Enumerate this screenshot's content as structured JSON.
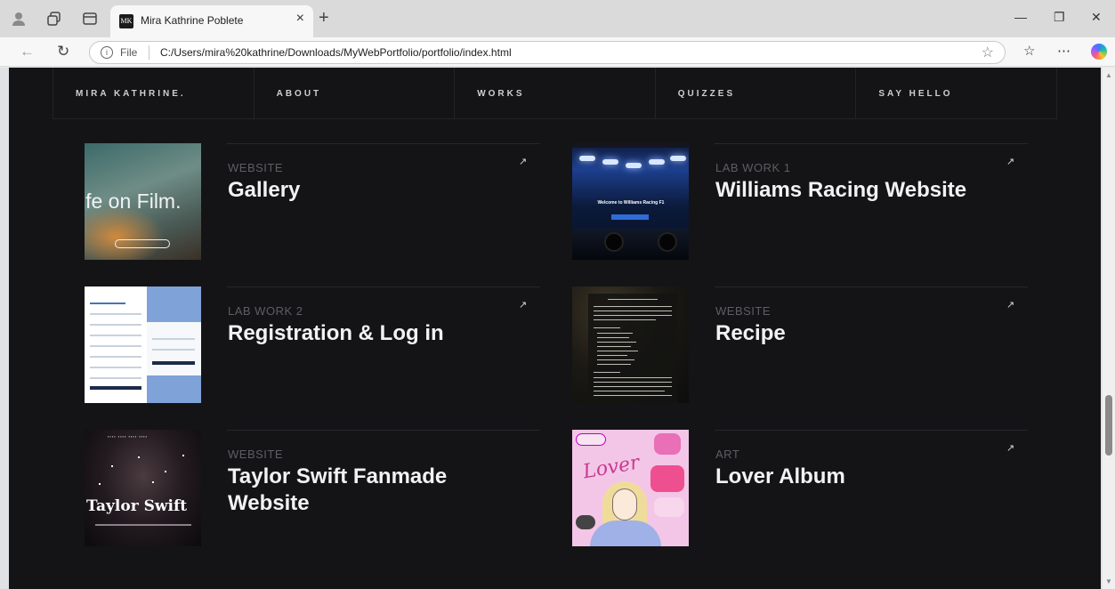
{
  "browser": {
    "tab": {
      "favicon_text": "MK",
      "title": "Mira Kathrine Poblete",
      "close": "×"
    },
    "new_tab": "+",
    "window_controls": {
      "minimize": "—",
      "restore": "❐",
      "close": "✕"
    },
    "address": {
      "scheme": "File",
      "url": "C:/Users/mira%20kathrine/Downloads/MyWebPortfolio/portfolio/index.html"
    }
  },
  "nav": {
    "items": [
      "MIRA KATHRINE.",
      "ABOUT",
      "WORKS",
      "QUIZZES",
      "SAY HELLO"
    ]
  },
  "projects": [
    {
      "category": "WEBSITE",
      "title": "Gallery",
      "thumb_text": "ife on Film."
    },
    {
      "category": "LAB WORK 1",
      "title": "Williams Racing Website",
      "thumb_text": "Welcome to Williams Racing F1"
    },
    {
      "category": "LAB WORK 2",
      "title": "Registration & Log in"
    },
    {
      "category": "WEBSITE",
      "title": "Recipe"
    },
    {
      "category": "WEBSITE",
      "title": "Taylor Swift Fanmade Website",
      "thumb_text": "Taylor Swift"
    },
    {
      "category": "ART",
      "title": "Lover Album",
      "thumb_text": "Lover"
    }
  ],
  "arrow_glyph": "↗",
  "colors": {
    "page_bg": "#141416",
    "title_text": "#f2f2f2",
    "category_text": "#5d5d63",
    "divider": "#27272b"
  }
}
